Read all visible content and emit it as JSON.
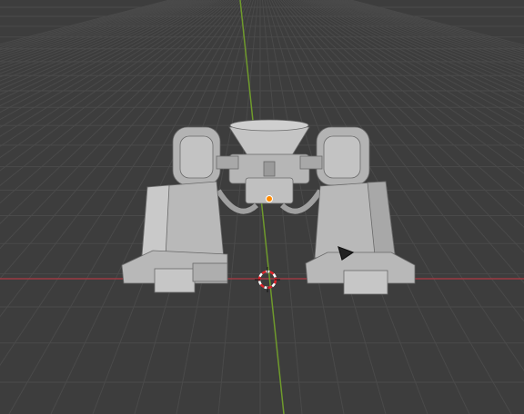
{
  "app": "3D viewport",
  "scene": {
    "object": "mech-legs",
    "icons": {
      "origin": "object-origin-icon",
      "cursor": "3d-cursor-icon",
      "light": "light-icon"
    }
  },
  "colors": {
    "background": "#3d3d3d",
    "grid": "#4a4a4a",
    "x_axis": "#9c3a43",
    "y_axis": "#6f9a2c",
    "model": "#bcbcbc",
    "model_shadow": "#8e8e8e",
    "origin": "#ff8a00",
    "cursor_red": "#e0232b"
  }
}
